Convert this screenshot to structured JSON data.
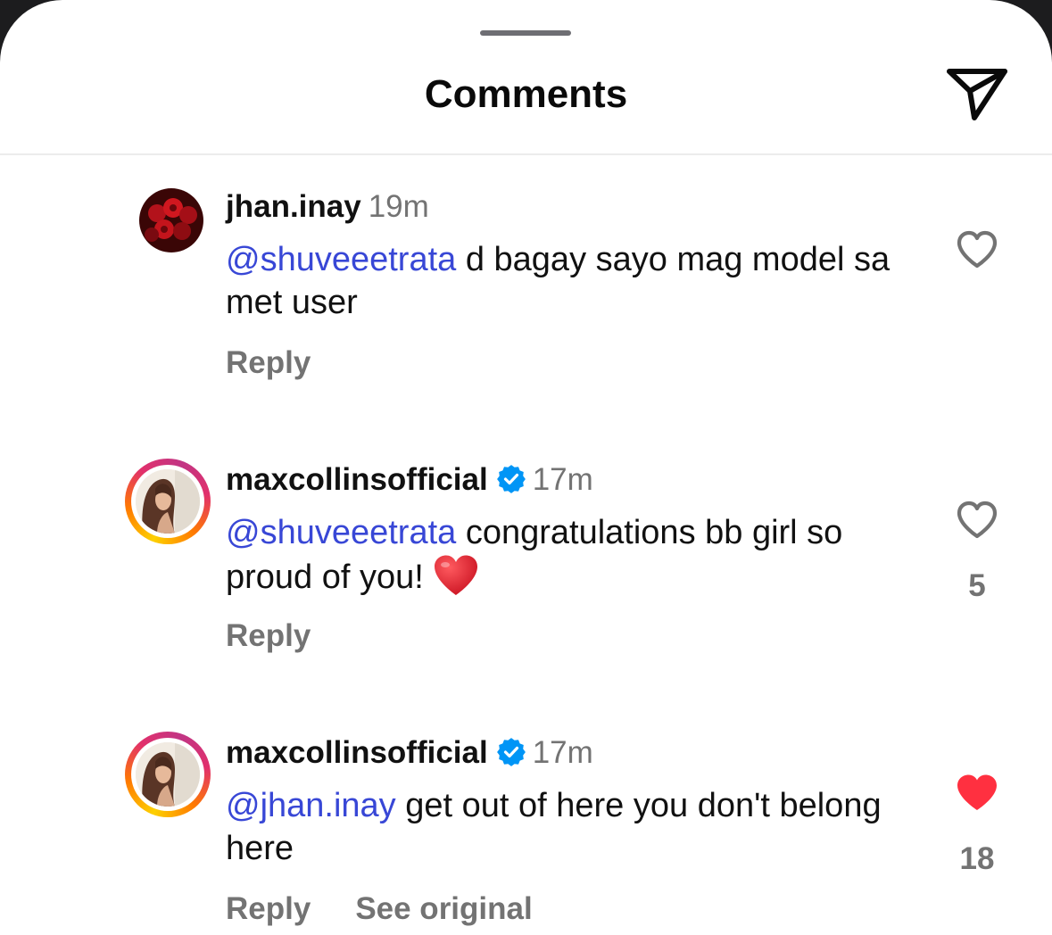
{
  "header": {
    "title": "Comments",
    "send_icon": "paper-plane-icon"
  },
  "comments": [
    {
      "username": "jhan.inay",
      "verified": false,
      "time": "19m",
      "mention": "@shuveeetrata",
      "text": " d bagay sayo mag model sa met user",
      "reply_label": "Reply",
      "liked": false,
      "like_count": ""
    },
    {
      "username": "maxcollinsofficial",
      "verified": true,
      "time": "17m",
      "mention": "@shuveeetrata",
      "text": " congratulations bb girl so proud of you!",
      "emoji": "red-heart",
      "reply_label": "Reply",
      "liked": false,
      "like_count": "5"
    },
    {
      "username": "maxcollinsofficial",
      "verified": true,
      "time": "17m",
      "mention": "@jhan.inay",
      "text": " get out of here you don't belong here",
      "reply_label": "Reply",
      "see_original_label": "See original",
      "liked": true,
      "like_count": "18"
    }
  ],
  "colors": {
    "mention": "#3847d6",
    "secondary_text": "#737373",
    "like_active": "#ff3040",
    "verified_badge": "#0095f6"
  }
}
